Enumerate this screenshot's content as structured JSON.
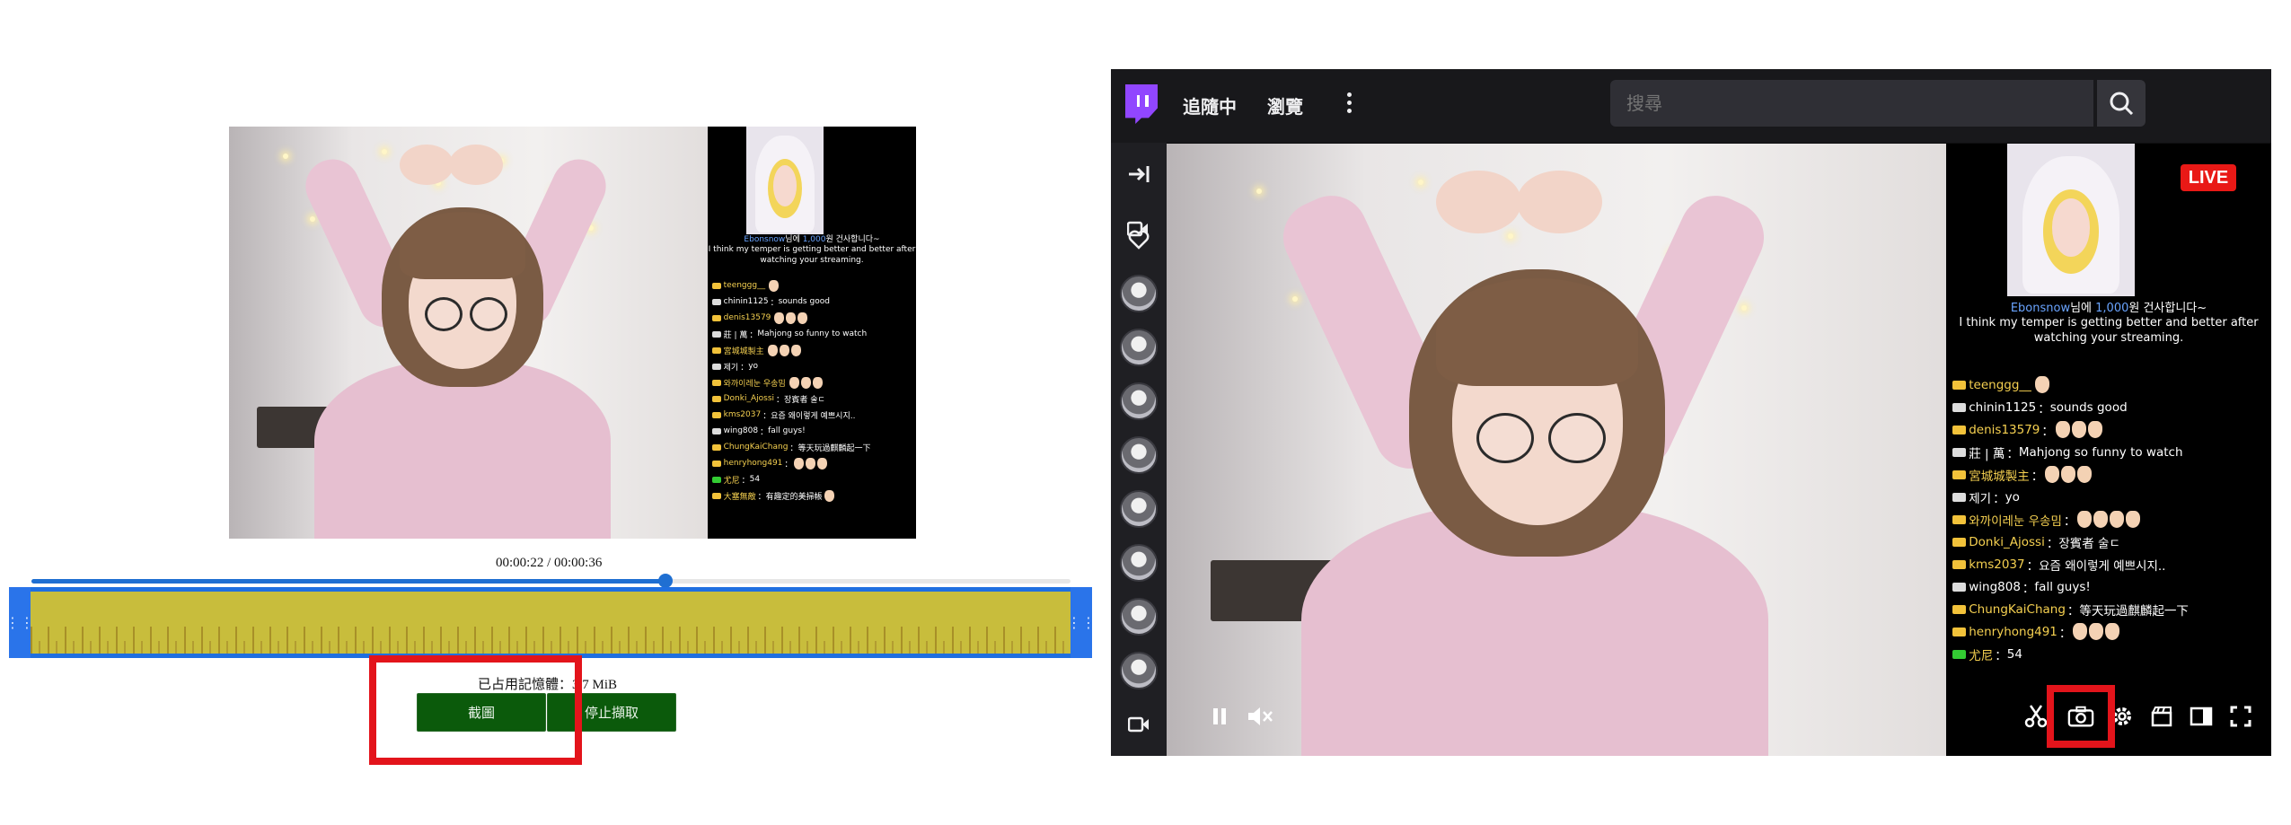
{
  "left_page": {
    "time_display": "00:00:22 / 00:00:36",
    "seek_progress": 0.61,
    "memory_label": "已占用記憶體：3.7 MiB",
    "screenshot_button": "截圖",
    "stop_capture_button": "停止擷取",
    "handle_glyph": "⋮⋮",
    "highlight_color": "#e3141b"
  },
  "stream_overlay": {
    "thanks_user": "Ebonsnow",
    "thanks_korean_a": "님에 ",
    "thanks_amount": "1,000",
    "thanks_korean_b": "원 건사합니다~",
    "thanks_message": "I think my temper is getting better and better after watching your streaming.",
    "chat": [
      {
        "user": "teenggg__",
        "text": ""
      },
      {
        "user": "chinin1125",
        "text": "sounds good"
      },
      {
        "user": "denis13579",
        "text": ""
      },
      {
        "user": "莊 | 萬",
        "text": "Mahjong so funny to watch"
      },
      {
        "user": "宮城城製主",
        "text": ""
      },
      {
        "user": "제기",
        "text": "yo"
      },
      {
        "user": "와까이레눈 우송밈",
        "text": ""
      },
      {
        "user": "Donki_Ajossi",
        "text": "장賓者 술ㄷ"
      },
      {
        "user": "kms2037",
        "text": "요즘 왜이렇게 예쁘시지.."
      },
      {
        "user": "wing808",
        "text": "fall guys!"
      },
      {
        "user": "ChungKaiChang",
        "text": "等天玩過麒麟起一下"
      },
      {
        "user": "henryhong491",
        "text": ""
      },
      {
        "user": "尤尼",
        "text": "54"
      },
      {
        "user": "大塞無敵",
        "text": "有趣定的美掃帳"
      }
    ]
  },
  "twitch": {
    "nav_following": "追隨中",
    "nav_browse": "瀏覽",
    "search_placeholder": "搜尋",
    "live_badge": "LIVE",
    "brand_color": "#9146ff",
    "live_color": "#e91916"
  }
}
